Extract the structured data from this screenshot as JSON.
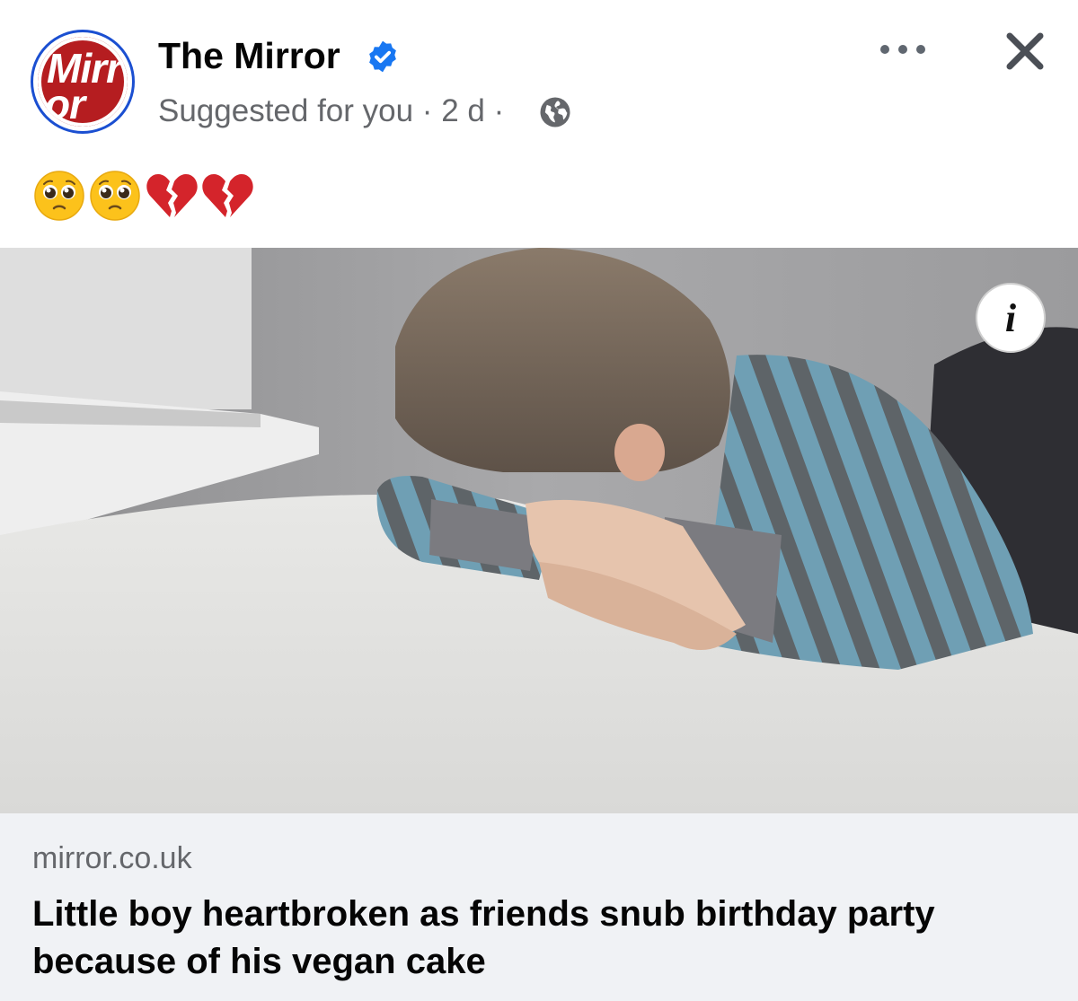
{
  "post": {
    "page_name": "The Mirror",
    "logo_text_line1": "Mirr",
    "logo_text_line2": "or",
    "subline": "Suggested for you · 2 d ·",
    "caption_emojis": [
      "pleading-face",
      "pleading-face",
      "broken-heart",
      "broken-heart"
    ]
  },
  "icons": {
    "verified": "verified-badge-icon",
    "globe": "globe-icon",
    "more": "more-options-icon",
    "close": "close-icon",
    "info": "info-icon"
  },
  "info_label": "i",
  "link_preview": {
    "domain": "mirror.co.uk",
    "headline": "Little boy heartbroken as friends snub birthday party because of his vegan cake"
  },
  "colors": {
    "brand_red": "#b51d20",
    "verified_blue": "#1877f2",
    "secondary_text": "#65676b",
    "link_box_bg": "#f0f2f5"
  }
}
